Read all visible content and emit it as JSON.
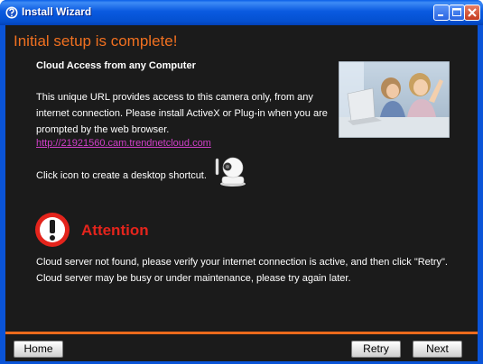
{
  "window": {
    "title": "Install Wizard",
    "icon": "wizard-icon",
    "controls": [
      "minimize-icon",
      "maximize-icon",
      "close-icon"
    ]
  },
  "main": {
    "heading": "Initial setup is complete!",
    "subheading": "Cloud Access from any Computer",
    "description": "This unique URL provides access to this camera only, from any internet connection. Please install ActiveX or Plug-in when you are prompted by the web browser.",
    "url": "http://21921560.cam.trendnetcloud.com",
    "shortcut_text": "Click icon to create a desktop shortcut.",
    "shortcut_icon": "camera-icon",
    "photo_icon": "photo-illustration"
  },
  "attention": {
    "label": "Attention",
    "icon": "warning-icon",
    "message_line1": "Cloud server not found, please verify your internet connection is active, and then click \"Retry\".",
    "message_line2": "Cloud server may be busy or under maintenance, please try again later."
  },
  "footer": {
    "home_label": "Home",
    "retry_label": "Retry",
    "next_label": "Next"
  },
  "colors": {
    "heading": "#f07020",
    "attention": "#e4241c",
    "link": "#d040c8",
    "divider": "#ec6a1c",
    "background": "#1b1b1b"
  }
}
